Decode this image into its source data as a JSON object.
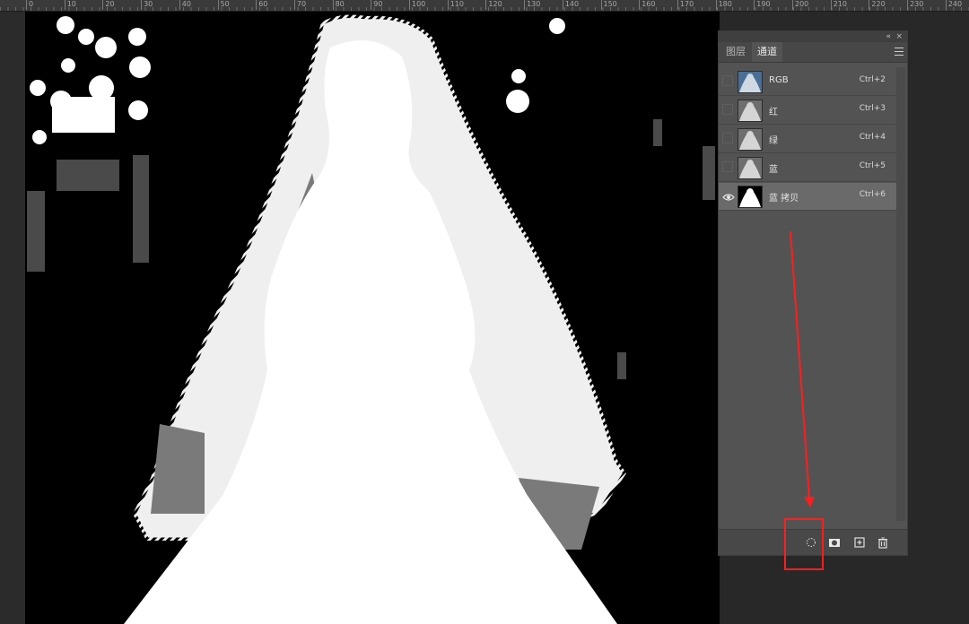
{
  "ruler": {
    "ticks": [
      "0",
      "10",
      "20",
      "30",
      "40",
      "50",
      "60",
      "70",
      "80",
      "90",
      "100",
      "110",
      "120",
      "130",
      "140",
      "150",
      "160",
      "170",
      "180",
      "190",
      "200",
      "210",
      "220",
      "230",
      "240"
    ]
  },
  "panel": {
    "tabs": [
      {
        "label": "图层",
        "active": false
      },
      {
        "label": "通道",
        "active": true
      }
    ],
    "collapse_icon": "«",
    "close_icon": "×",
    "channels": [
      {
        "name": "RGB",
        "shortcut": "Ctrl+2",
        "visible": false,
        "selected": false,
        "thumb": "color"
      },
      {
        "name": "红",
        "shortcut": "Ctrl+3",
        "visible": false,
        "selected": false,
        "thumb": "gray"
      },
      {
        "name": "绿",
        "shortcut": "Ctrl+4",
        "visible": false,
        "selected": false,
        "thumb": "gray"
      },
      {
        "name": "蓝",
        "shortcut": "Ctrl+5",
        "visible": false,
        "selected": false,
        "thumb": "gray"
      },
      {
        "name": "蓝 拷贝",
        "shortcut": "Ctrl+6",
        "visible": true,
        "selected": true,
        "thumb": "mask"
      }
    ],
    "footer_buttons": [
      {
        "icon": "load-channel-as-selection-icon"
      },
      {
        "icon": "save-selection-as-channel-icon"
      },
      {
        "icon": "new-channel-icon"
      },
      {
        "icon": "delete-channel-icon"
      }
    ]
  },
  "colors": {
    "highlight": "#ff1e1e",
    "panel": "#535353",
    "selected_row": "#6a6a6a"
  }
}
